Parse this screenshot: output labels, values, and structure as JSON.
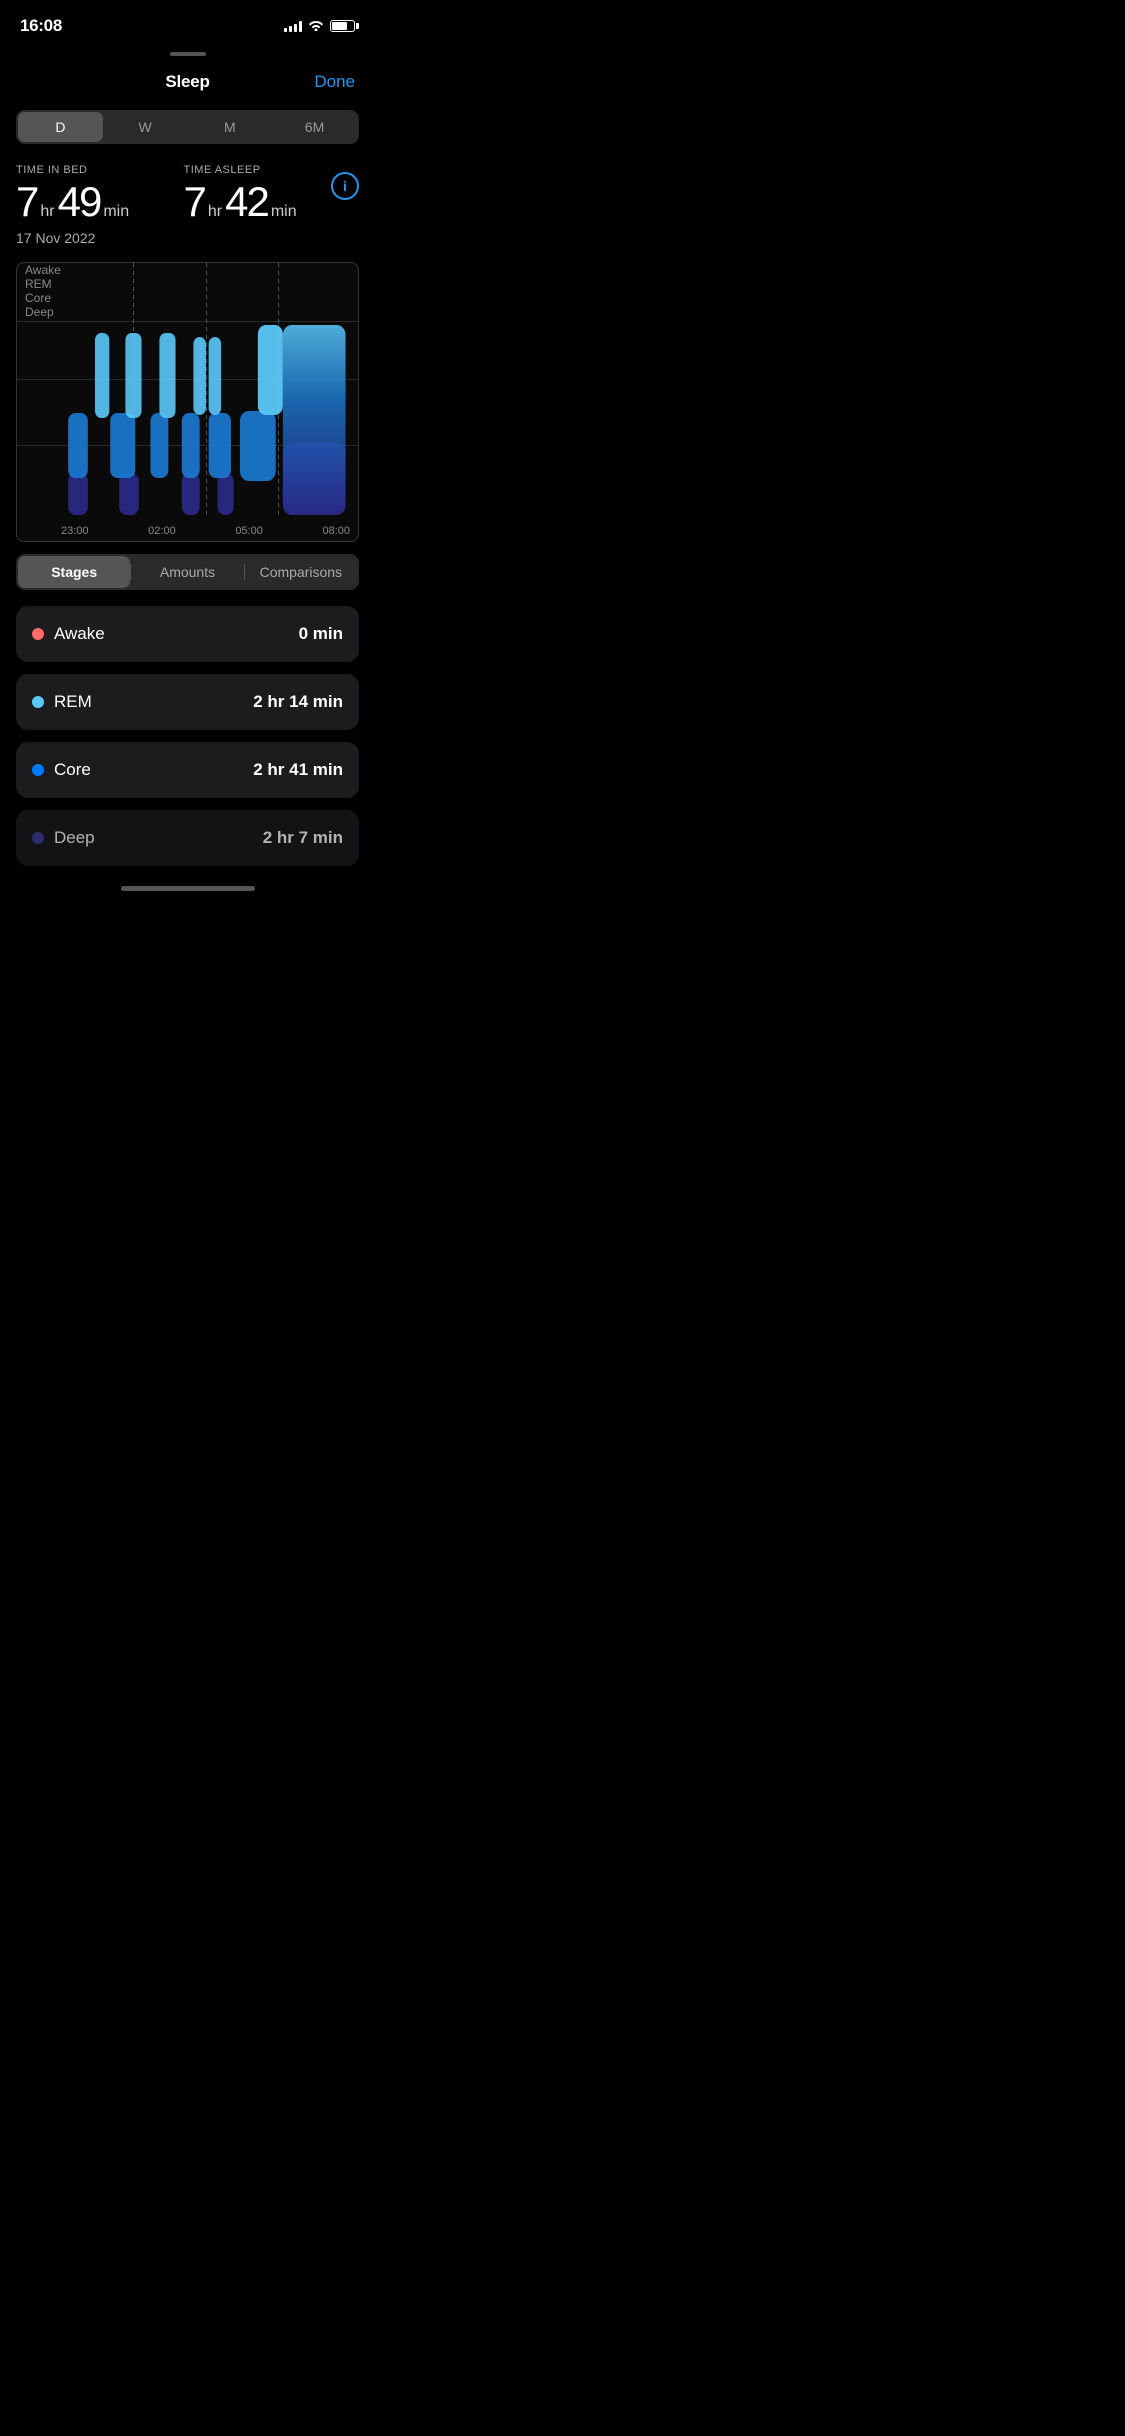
{
  "statusBar": {
    "time": "16:08"
  },
  "nav": {
    "title": "Sleep",
    "done": "Done"
  },
  "periodSelector": {
    "options": [
      "D",
      "W",
      "M",
      "6M"
    ],
    "active": "D"
  },
  "stats": {
    "timeInBed": {
      "label": "TIME IN BED",
      "hr": "7",
      "min": "49",
      "hrUnit": "hr",
      "minUnit": "min"
    },
    "timeAsleep": {
      "label": "TIME ASLEEP",
      "hr": "7",
      "min": "42",
      "hrUnit": "hr",
      "minUnit": "min"
    },
    "date": "17 Nov 2022"
  },
  "chart": {
    "yLabels": [
      "Awake",
      "REM",
      "Core",
      "Deep"
    ],
    "xLabels": [
      "23:00",
      "02:00",
      "05:00",
      "08:00"
    ]
  },
  "tabs": {
    "options": [
      "Stages",
      "Amounts",
      "Comparisons"
    ],
    "active": "Stages"
  },
  "stageCards": [
    {
      "name": "Awake",
      "value": "0 min",
      "dotColor": "#FF6B6B"
    },
    {
      "name": "REM",
      "value": "2 hr 14 min",
      "dotColor": "#5AC8FA"
    },
    {
      "name": "Core",
      "value": "2 hr 41 min",
      "dotColor": "#007AFF"
    },
    {
      "name": "Deep",
      "value": "2 hr 7 min",
      "dotColor": "#3F3F9F"
    }
  ]
}
